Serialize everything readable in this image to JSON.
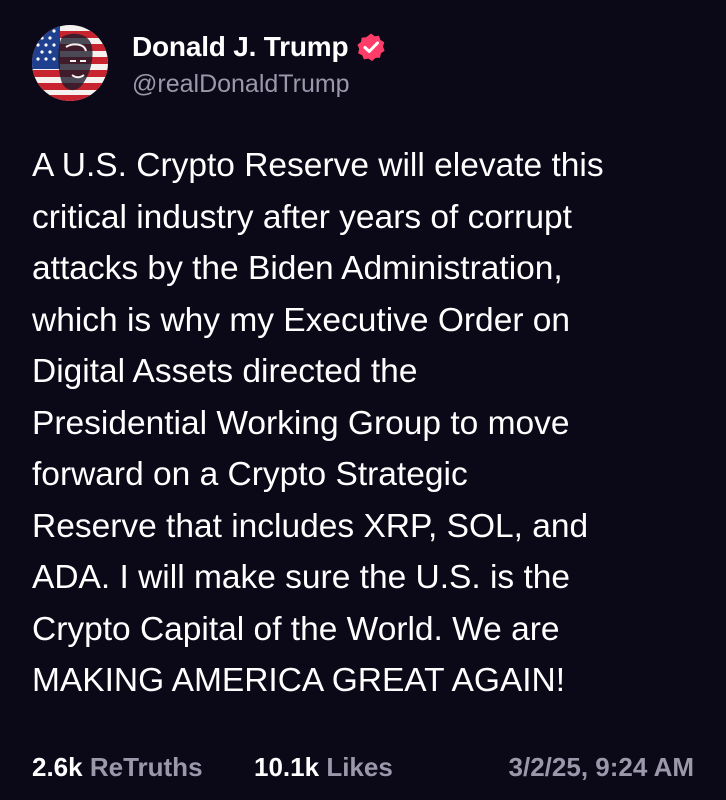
{
  "author": {
    "display_name": "Donald J. Trump",
    "handle": "@realDonaldTrump",
    "verified": true,
    "verified_color": "#ff3d68",
    "avatar_icon": "avatar-flag-portrait"
  },
  "post": {
    "lines": [
      "A U.S. Crypto Reserve will elevate this",
      "critical industry after years of corrupt",
      "attacks by the Biden Administration,",
      "which is why my Executive Order on",
      "Digital Assets directed the",
      "Presidential Working Group to move",
      "forward on a Crypto Strategic",
      "Reserve that includes XRP, SOL, and",
      "ADA. I will make sure the U.S. is the",
      "Crypto Capital of the World. We are",
      "MAKING AMERICA GREAT AGAIN!"
    ]
  },
  "stats": {
    "retruths_count": "2.6k",
    "retruths_label": "ReTruths",
    "likes_count": "10.1k",
    "likes_label": "Likes",
    "timestamp": "3/2/25, 9:24 AM"
  },
  "colors": {
    "background": "#0b0817",
    "text": "#ffffff",
    "muted": "#9c98ab"
  }
}
